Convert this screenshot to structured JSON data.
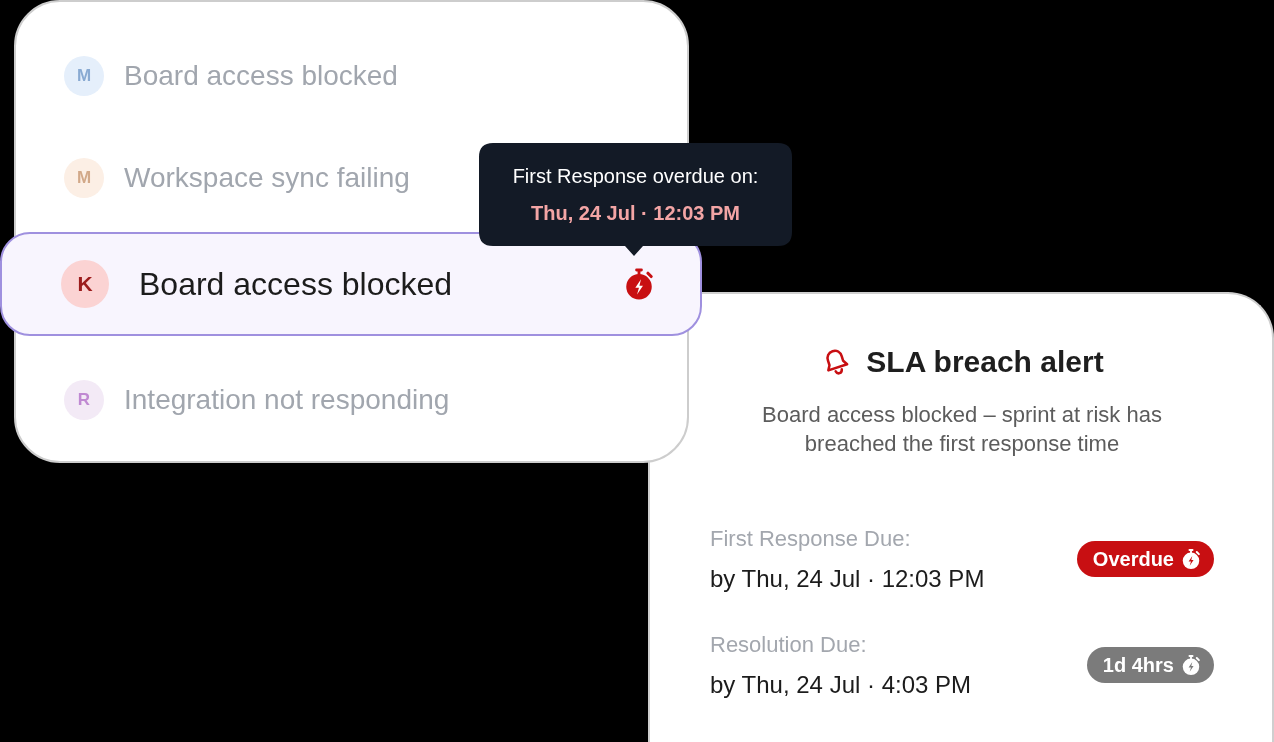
{
  "tickets": [
    {
      "initial": "M",
      "title": "Board access blocked",
      "color": "#e5effb",
      "selected": false,
      "breached": false
    },
    {
      "initial": "M",
      "title": "Workspace sync failing",
      "color": "#fcefe5",
      "selected": false,
      "breached": false
    },
    {
      "initial": "K",
      "title": "Board access blocked",
      "color": "#fbd3d3",
      "selected": true,
      "breached": true
    },
    {
      "initial": "R",
      "title": "Integration not responding",
      "color": "#f3eaf6",
      "selected": false,
      "breached": false
    }
  ],
  "tooltip": {
    "label": "First Response overdue on:",
    "value": "Thu, 24 Jul · 12:03 PM"
  },
  "alert": {
    "title": "SLA breach alert",
    "message": "Board access blocked – sprint at risk has breached the first response time",
    "fields": [
      {
        "label": "First Response Due:",
        "value": "by Thu, 24 Jul · 12:03 PM",
        "badge": {
          "text": "Overdue",
          "kind": "overdue"
        }
      },
      {
        "label": "Resolution Due:",
        "value": "by Thu, 24 Jul · 4:03 PM",
        "badge": {
          "text": "1d 4hrs",
          "kind": "remaining"
        }
      }
    ]
  }
}
